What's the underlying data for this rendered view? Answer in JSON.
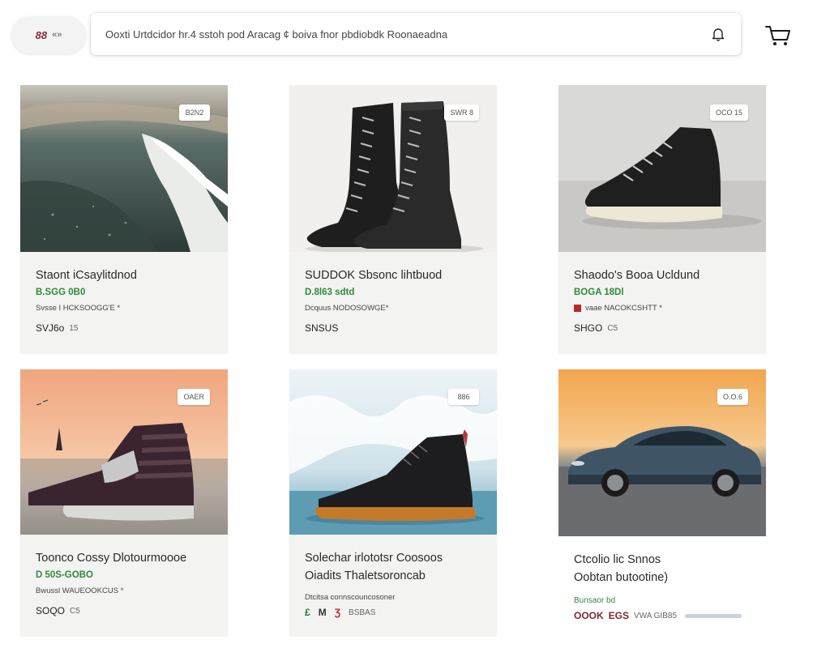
{
  "header": {
    "logo_text": "«»",
    "logo_mark": "88",
    "search_placeholder": "Ooxti Urtdcidor hr.4 sstoh pod Aracag ¢ boiva fnor pbdiobdk Roonaeadna"
  },
  "products": [
    {
      "badge": "B2N2",
      "title": "Staont iCsaylitdnod",
      "price": "B.SGG 0B0",
      "meta": "Svsse  I HCKSOOGG'E *",
      "bottom": "SVJ6o",
      "bottom_suffix": "15"
    },
    {
      "badge": "SWR 8",
      "title": "SUDDOK Sbsonc lihtbuod",
      "price": "D.8l63 sdtd",
      "meta": "Dcquus  NODOSOWGE*",
      "bottom": "SNSUS",
      "bottom_suffix": ""
    },
    {
      "badge": "OCO 15",
      "title": "Shaodo's Booa Ucldund",
      "price": "BOGA 18Dl",
      "meta": "vaae  NACOKCSHTT *",
      "bottom": "SHGO",
      "bottom_suffix": "C5"
    },
    {
      "badge": "OAER",
      "title": "Toonco Cossy Dlotourmoooe",
      "price": "D 50S-GOBO",
      "meta": "Bwussl  WAUEOOKCUS *",
      "bottom": "SOQO",
      "bottom_suffix": "C5"
    },
    {
      "badge": "886",
      "title": "Solechar irlototsr Coosoos",
      "title2": "Oiadits Thaletsoroncab",
      "price": "",
      "meta": "Dtcitsa connscouncosoner",
      "sizes": [
        "£",
        "M",
        "Ʒ"
      ],
      "bottom_suffix": "BSBAS"
    },
    {
      "badge": "O.O.6",
      "title": "Ctcolio lic Snnos",
      "title2": "Oobtan butootine)",
      "price": "",
      "meta": "Bunsaor bd",
      "bottom": "OOOK",
      "bottom_bold": "EGS",
      "bottom_suffix": "VWA GIB85"
    }
  ],
  "colors": {
    "price_green": "#2f8a3a",
    "accent_red": "#b8282e"
  }
}
